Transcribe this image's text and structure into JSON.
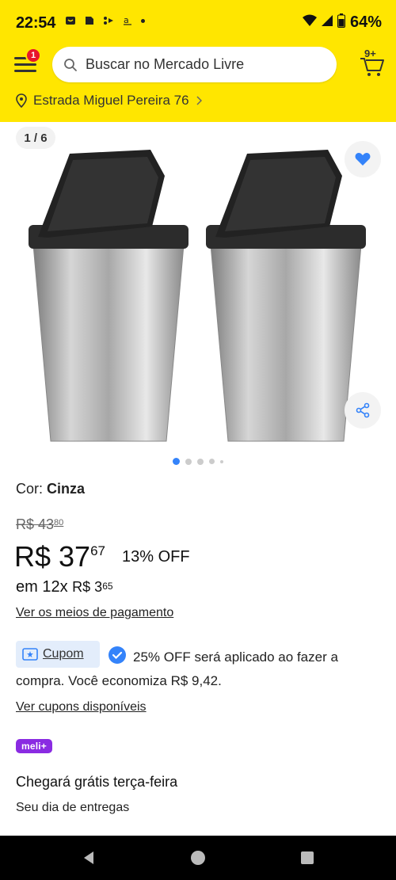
{
  "status_bar": {
    "time": "22:54",
    "battery": "64%"
  },
  "header": {
    "menu_badge": "1",
    "search_placeholder": "Buscar no Mercado Livre",
    "cart_count": "9+",
    "address": "Estrada Miguel Pereira 76"
  },
  "gallery": {
    "counter": "1 / 6",
    "pages": 6,
    "active_page": 1
  },
  "product": {
    "color_label": "Cor: ",
    "color_value": "Cinza",
    "old_price_main": "R$ 43",
    "old_price_cents": "80",
    "price_main": "R$ 37",
    "price_cents": "67",
    "discount": "13% OFF",
    "installment_prefix": "em 12x",
    "installment_main": "R$ 3",
    "installment_cents": "65",
    "payment_link": "Ver os meios de pagamento"
  },
  "coupon": {
    "tag": "Cupom",
    "text": "25% OFF será aplicado ao fazer a compra. Você economiza R$ 9,42.",
    "link": "Ver cupons disponíveis"
  },
  "shipping": {
    "badge": "meli+",
    "title": "Chegará grátis terça-feira",
    "subtitle": "Seu dia de entregas"
  },
  "colors": {
    "brand_yellow": "#ffe600",
    "accent_blue": "#3483fa",
    "badge_red": "#e8162c",
    "meli_purple": "#8a2be2"
  }
}
